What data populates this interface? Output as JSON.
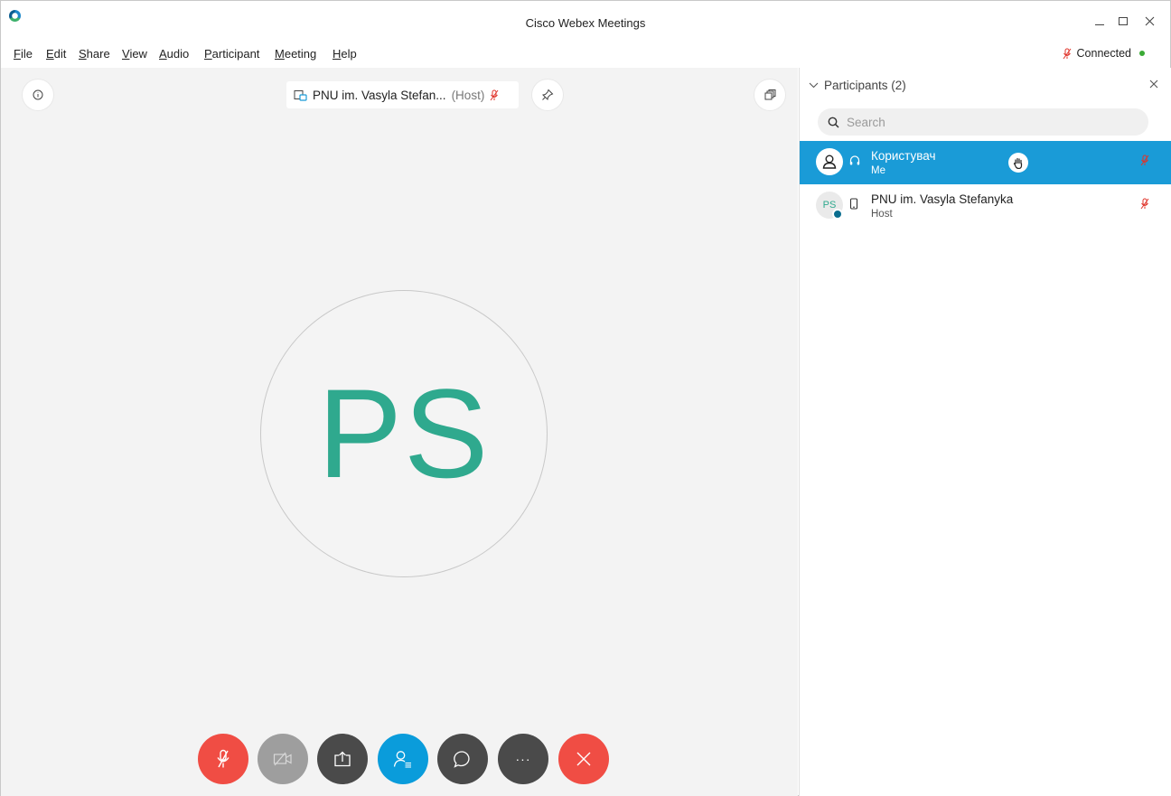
{
  "window": {
    "title": "Cisco Webex Meetings",
    "logo_icon": "webex-logo-icon"
  },
  "menu": {
    "items": [
      {
        "accel": "F",
        "rest": "ile"
      },
      {
        "accel": "E",
        "rest": "dit"
      },
      {
        "accel": "S",
        "rest": "hare"
      },
      {
        "accel": "V",
        "rest": "iew"
      },
      {
        "accel": "A",
        "rest": "udio"
      },
      {
        "accel": "P",
        "rest": "articipant"
      },
      {
        "accel": "M",
        "rest": "eeting"
      },
      {
        "accel": "H",
        "rest": "elp"
      }
    ]
  },
  "connection": {
    "status": "Connected",
    "dot_color": "#3aaa35"
  },
  "stage": {
    "active_speaker": {
      "name": "PNU im. Vasyla Stefan...",
      "tag": "(Host)"
    },
    "avatar_initials": "PS",
    "avatar_color": "#2fa98e"
  },
  "controls": {
    "mute_icon": "mic-muted-icon",
    "video_icon": "video-off-icon",
    "share_icon": "share-icon",
    "participants_icon": "participants-icon",
    "chat_icon": "chat-icon",
    "more_label": "···",
    "leave_icon": "close-icon",
    "colors": {
      "danger": "#f04d44",
      "active": "#0a9cdb",
      "neutral": "#4a4a4a",
      "disabled": "#9e9e9e"
    }
  },
  "panel": {
    "title": "Participants (2)",
    "search_placeholder": "Search",
    "participants": [
      {
        "name": "Користувач",
        "role": "Me",
        "selected": true,
        "raised_hand": true,
        "muted": true
      },
      {
        "name": "PNU im. Vasyla Stefanyka",
        "role": "Host",
        "initials": "PS",
        "selected": false,
        "muted": true
      }
    ],
    "selected_color": "#1a9bd7"
  }
}
